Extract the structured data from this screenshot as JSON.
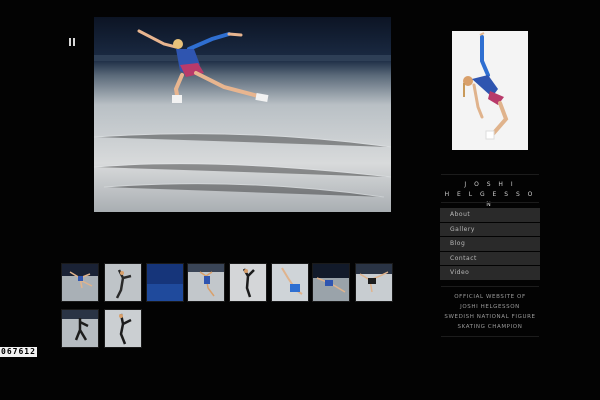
{
  "slideshow": {
    "pause_label": "pause",
    "current_index": 0
  },
  "thumbnails": [
    "thumb-1",
    "thumb-2",
    "thumb-3",
    "thumb-4",
    "thumb-5",
    "thumb-6",
    "thumb-7",
    "thumb-8",
    "thumb-9",
    "thumb-10"
  ],
  "sidebar": {
    "name_line1": "J O S H I",
    "name_line2": "H E L G E S S O N",
    "nav": [
      "About",
      "Gallery",
      "Blog",
      "Contact",
      "Video"
    ],
    "tagline": [
      "OFFICIAL WEBSITE OF",
      "JOSHI HELGESSON",
      "SWEDISH NATIONAL FIGURE",
      "SKATING CHAMPION"
    ]
  },
  "counter": "067612",
  "colors": {
    "background": "#030303",
    "nav_bg": "#2a2a2a",
    "ice": "#cfd3d6",
    "costume": "#2f4fa8"
  }
}
